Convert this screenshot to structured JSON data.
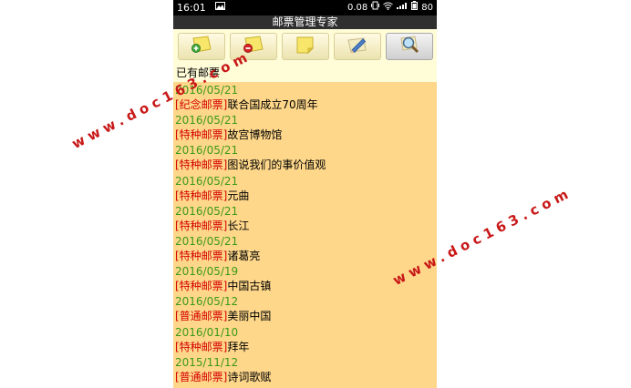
{
  "status_bar": {
    "time": "16:01",
    "net_speed": "0.08",
    "battery": "80"
  },
  "app": {
    "title": "邮票管理专家"
  },
  "toolbar": {
    "buttons": [
      {
        "icon": "add-stamp-icon"
      },
      {
        "icon": "remove-stamp-icon"
      },
      {
        "icon": "note-icon"
      },
      {
        "icon": "edit-icon"
      },
      {
        "icon": "search-icon"
      }
    ]
  },
  "section": {
    "header": "已有邮票"
  },
  "stamps": [
    {
      "date": "2016/05/21",
      "category": "[纪念邮票]",
      "name": "联合国成立70周年"
    },
    {
      "date": "2016/05/21",
      "category": "[特种邮票]",
      "name": "故宫博物馆"
    },
    {
      "date": "2016/05/21",
      "category": "[特种邮票]",
      "name": "图说我们的事价值观"
    },
    {
      "date": "2016/05/21",
      "category": "[特种邮票]",
      "name": "元曲"
    },
    {
      "date": "2016/05/21",
      "category": "[特种邮票]",
      "name": "长江"
    },
    {
      "date": "2016/05/21",
      "category": "[特种邮票]",
      "name": "诸葛亮"
    },
    {
      "date": "2016/05/19",
      "category": "[特种邮票]",
      "name": "中国古镇"
    },
    {
      "date": "2016/05/12",
      "category": "[普通邮票]",
      "name": "美丽中国"
    },
    {
      "date": "2016/01/10",
      "category": "[特种邮票]",
      "name": "拜年"
    },
    {
      "date": "2015/11/12",
      "category": "[普通邮票]",
      "name": "诗词歌赋"
    }
  ],
  "watermark": {
    "text": "www.doc163.com"
  },
  "colors": {
    "list_background": "#fed78a",
    "toolbar_background": "#fffcd8",
    "date_color": "#3a9a16",
    "category_color": "#d40000",
    "watermark_color": "#c81818"
  }
}
